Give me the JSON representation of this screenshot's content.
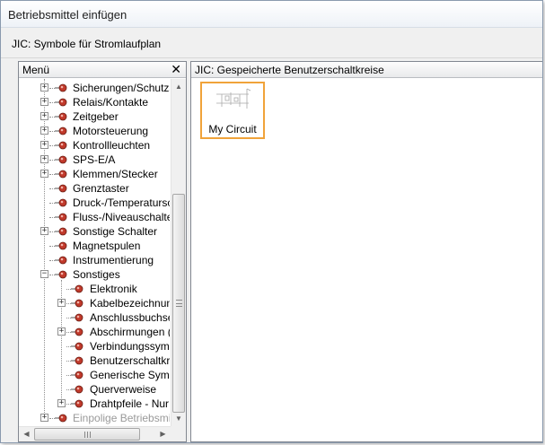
{
  "window": {
    "title": "Betriebsmittel einfügen"
  },
  "subtitle": "JIC: Symbole für Stromlaufplan",
  "left_panel": {
    "header": "Menü",
    "close_glyph": "✕",
    "tree": [
      {
        "label": "Sicherungen/Schutzsc",
        "expander": "+"
      },
      {
        "label": "Relais/Kontakte",
        "expander": "+"
      },
      {
        "label": "Zeitgeber",
        "expander": "+"
      },
      {
        "label": "Motorsteuerung",
        "expander": "+"
      },
      {
        "label": "Kontrollleuchten",
        "expander": "+"
      },
      {
        "label": "SPS-E/A",
        "expander": "+"
      },
      {
        "label": "Klemmen/Stecker",
        "expander": "+"
      },
      {
        "label": "Grenztaster",
        "expander": ""
      },
      {
        "label": "Druck-/Temperatursch",
        "expander": ""
      },
      {
        "label": "Fluss-/Niveauschalter",
        "expander": ""
      },
      {
        "label": "Sonstige Schalter",
        "expander": "+"
      },
      {
        "label": "Magnetspulen",
        "expander": ""
      },
      {
        "label": "Instrumentierung",
        "expander": ""
      },
      {
        "label": "Sonstiges",
        "expander": "−"
      },
      {
        "label": "Elektronik",
        "expander": ""
      },
      {
        "label": "Kabelbezeichnunge",
        "expander": "+"
      },
      {
        "label": "Anschlussbuchsen",
        "expander": ""
      },
      {
        "label": "Abschirmungen (nic",
        "expander": "+"
      },
      {
        "label": "Verbindungssymbol",
        "expander": ""
      },
      {
        "label": "Benutzerschaltkreis",
        "expander": ""
      },
      {
        "label": "Generische Symbol",
        "expander": ""
      },
      {
        "label": "Querverweise",
        "expander": ""
      },
      {
        "label": "Drahtpfeile - Nur Re",
        "expander": "+"
      },
      {
        "label": "Einpolige Betriebsmittel",
        "expander": "+"
      }
    ]
  },
  "right_panel": {
    "header": "JIC: Gespeicherte Benutzerschaltkreise",
    "tiles": [
      {
        "label": "My Circuit"
      }
    ]
  },
  "colors": {
    "selection_border": "#f0a33a",
    "icon_red": "#c0392b"
  }
}
